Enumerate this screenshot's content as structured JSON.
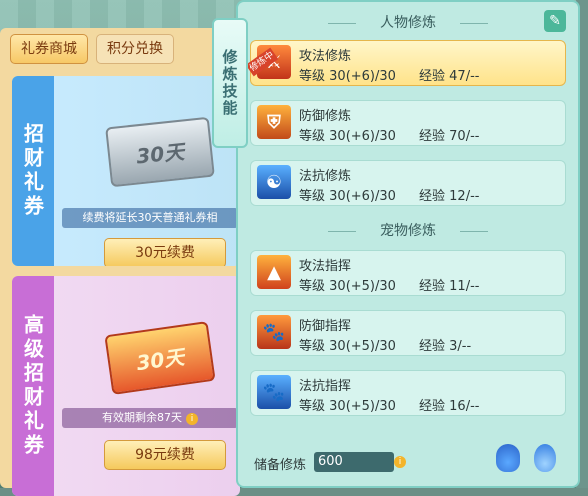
{
  "shop": {
    "tabs": [
      {
        "label": "礼券商城",
        "active": true
      },
      {
        "label": "积分兑换",
        "active": false
      }
    ],
    "cards": [
      {
        "side_title": "招财礼券",
        "ticket_text": "30天",
        "notice": "续费将延长30天普通礼券相",
        "button": "30元续费"
      },
      {
        "side_title": "高级招财礼券",
        "ticket_text": "30天",
        "notice": "有效期剩余87天",
        "button": "98元续费"
      }
    ]
  },
  "cultivation": {
    "tab_label": "修炼技能",
    "person_section": "人物修炼",
    "pet_section": "宠物修炼",
    "level_label": "等级",
    "exp_label": "经验",
    "person_skills": [
      {
        "name": "攻法修炼",
        "level": "30(+6)/30",
        "exp": "47/--",
        "active": true,
        "badge": "修炼中",
        "icon": "attack-cultivation-icon"
      },
      {
        "name": "防御修炼",
        "level": "30(+6)/30",
        "exp": "70/--",
        "active": false,
        "icon": "defense-cultivation-icon"
      },
      {
        "name": "法抗修炼",
        "level": "30(+6)/30",
        "exp": "12/--",
        "active": false,
        "icon": "magic-resist-cultivation-icon"
      }
    ],
    "pet_skills": [
      {
        "name": "攻法指挥",
        "level": "30(+5)/30",
        "exp": "11/--",
        "icon": "pet-attack-command-icon"
      },
      {
        "name": "防御指挥",
        "level": "30(+5)/30",
        "exp": "3/--",
        "icon": "pet-defense-command-icon"
      },
      {
        "name": "法抗指挥",
        "level": "30(+5)/30",
        "exp": "16/--",
        "icon": "pet-resist-command-icon"
      }
    ],
    "reserve_label": "储备修炼",
    "reserve_value": "600"
  },
  "colors": {
    "accent": "#7fcfc4",
    "active_row": "#ffe38a",
    "badge": "#d8432b"
  }
}
